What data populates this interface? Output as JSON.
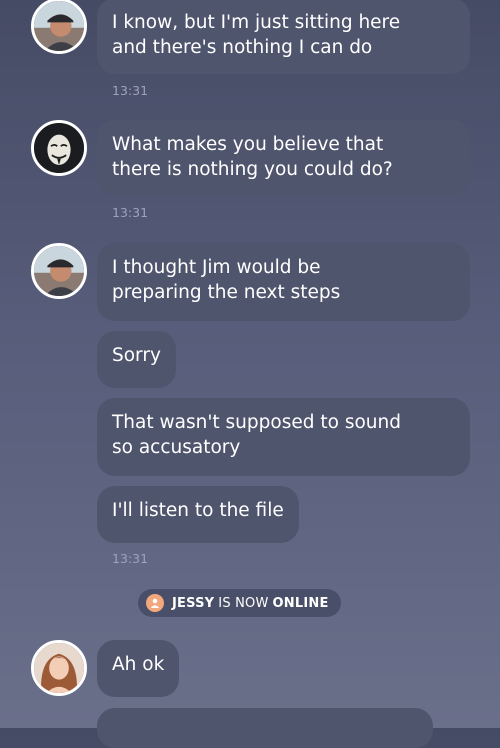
{
  "messages": [
    {
      "text": "I know, but I'm just sitting here\nand there's nothing I can do",
      "time": "13:31"
    },
    {
      "text": "What makes you believe that\nthere is nothing you could do?",
      "time": "13:31"
    },
    {
      "text": "I thought Jim would be\npreparing the next steps"
    },
    {
      "text": "Sorry"
    },
    {
      "text": "That wasn't supposed to sound\nso accusatory"
    },
    {
      "text": "I'll listen to the file",
      "time": "13:31"
    },
    {
      "text": "Ah ok"
    }
  ],
  "status": {
    "name": "JESSY",
    "middle": "IS NOW",
    "state": "ONLINE"
  },
  "avatars": {
    "user_a": "man-with-cap-icon",
    "user_b": "masked-face-icon",
    "jessy": "woman-portrait-icon"
  },
  "colors": {
    "bubble": "#50556e",
    "status_icon": "#f3a77c",
    "background": "#575d7a"
  }
}
